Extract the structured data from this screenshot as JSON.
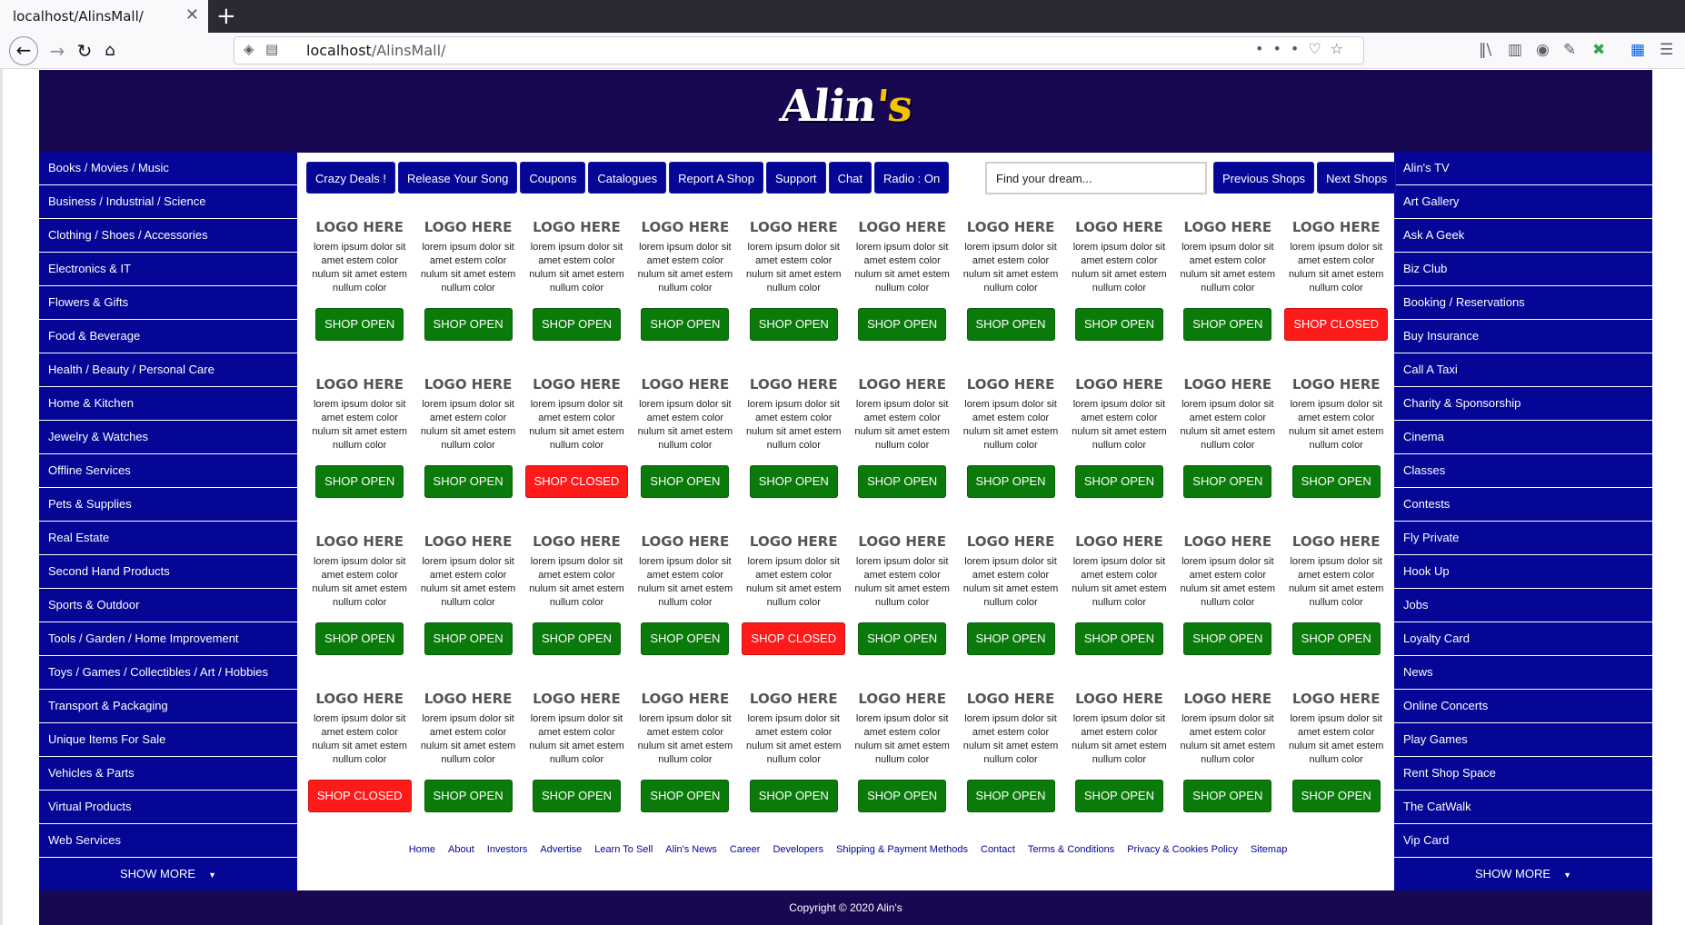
{
  "browser": {
    "tab_title": "localhost/AlinsMall/",
    "tab_close": "✕",
    "new_tab": "+",
    "url_host": "localhost",
    "url_path": "/AlinsMall/",
    "url_menu": "•••"
  },
  "header": {
    "logo_main": "Alin",
    "logo_suffix": "'s"
  },
  "left_sidebar": [
    "Books / Movies / Music",
    "Business / Industrial / Science",
    "Clothing / Shoes / Accessories",
    "Electronics & IT",
    "Flowers & Gifts",
    "Food & Beverage",
    "Health / Beauty / Personal Care",
    "Home & Kitchen",
    "Jewelry & Watches",
    "Offline Services",
    "Pets & Supplies",
    "Real Estate",
    "Second Hand Products",
    "Sports & Outdoor",
    "Tools / Garden / Home Improvement",
    "Toys / Games / Collectibles / Art / Hobbies",
    "Transport & Packaging",
    "Unique Items For Sale",
    "Vehicles & Parts",
    "Virtual Products",
    "Web Services"
  ],
  "right_sidebar": [
    "Alin's TV",
    "Art Gallery",
    "Ask A Geek",
    "Biz Club",
    "Booking / Reservations",
    "Buy Insurance",
    "Call A Taxi",
    "Charity & Sponsorship",
    "Cinema",
    "Classes",
    "Contests",
    "Fly Private",
    "Hook Up",
    "Jobs",
    "Loyalty Card",
    "News",
    "Online Concerts",
    "Play Games",
    "Rent Shop Space",
    "The CatWalk",
    "Vip Card"
  ],
  "show_more": "SHOW MORE",
  "top_nav": [
    "Crazy Deals !",
    "Release Your Song",
    "Coupons",
    "Catalogues",
    "Report A Shop",
    "Support",
    "Chat",
    "Radio : On"
  ],
  "search": {
    "placeholder": "Find your dream..."
  },
  "paging": {
    "previous": "Previous Shops",
    "next": "Next Shops"
  },
  "shop_card": {
    "logo": "LOGO HERE",
    "description": "lorem ipsum dolor sit amet estem color nulum sit amet estem nullum color"
  },
  "status_labels": {
    "open": "SHOP OPEN",
    "closed": "SHOP CLOSED"
  },
  "shop_status_rows": [
    [
      "open",
      "open",
      "open",
      "open",
      "open",
      "open",
      "open",
      "open",
      "open",
      "closed"
    ],
    [
      "open",
      "open",
      "closed",
      "open",
      "open",
      "open",
      "open",
      "open",
      "open",
      "open"
    ],
    [
      "open",
      "open",
      "open",
      "open",
      "closed",
      "open",
      "open",
      "open",
      "open",
      "open"
    ],
    [
      "closed",
      "open",
      "open",
      "open",
      "open",
      "open",
      "open",
      "open",
      "open",
      "open"
    ]
  ],
  "footer_links": [
    "Home",
    "About",
    "Investors",
    "Advertise",
    "Learn To Sell",
    "Alin's News",
    "Career",
    "Developers",
    "Shipping & Payment Methods",
    "Contact",
    "Terms & Conditions",
    "Privacy & Cookies Policy",
    "Sitemap"
  ],
  "copyright": "Copyright © 2020 Alin's",
  "colors": {
    "header": "#180852",
    "nav_blue": "#050596",
    "open_green": "#0a7a0a",
    "closed_red": "#ff1a1a",
    "logo_accent": "#f5c400"
  }
}
